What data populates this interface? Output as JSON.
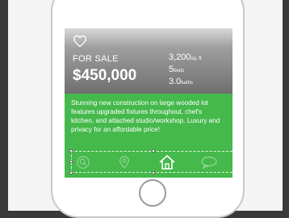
{
  "listing": {
    "status": "FOR SALE",
    "price": "$450,000",
    "sqft_value": "3,200",
    "sqft_unit": "sq. ft",
    "beds_value": "5",
    "beds_unit": "beds",
    "baths_value": "3.0",
    "baths_unit": "baths",
    "description": "Stunning new construction on large wooded lot features upgraded fixtures throughout, chef's kitchen, and attached studio/workshop. Luxury and privacy for an affordable price!"
  },
  "icons": [
    "heart-icon",
    "search-icon",
    "location-pin-icon",
    "home-icon",
    "chat-bubble-icon"
  ],
  "colors": {
    "details_green": "#45b94b",
    "hero_gray": "#6f6f6f",
    "text": "#ffffff"
  }
}
